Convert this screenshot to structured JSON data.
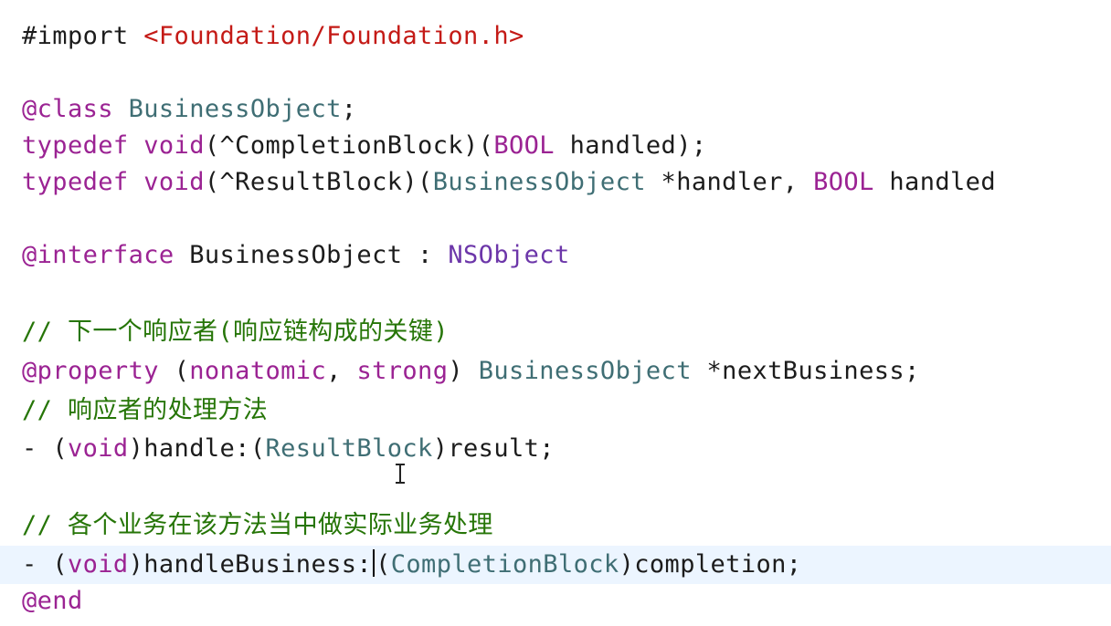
{
  "editor": {
    "import_directive": "#import",
    "import_path": "<Foundation/Foundation.h>",
    "class_keyword": "@class",
    "class_name": "BusinessObject",
    "semicolon": ";",
    "typedef_keyword": "typedef",
    "void_keyword": "void",
    "completion_block_text": "(^CompletionBlock)(",
    "bool_type": "BOOL",
    "handled_param": " handled);",
    "result_block_text": "(^ResultBlock)(",
    "business_object_type": "BusinessObject",
    "handler_param": " *handler, ",
    "handled_param_cut": " handled",
    "interface_keyword": "@interface",
    "interface_name": "BusinessObject",
    "colon": " : ",
    "superclass": "NSObject",
    "comment_next_responder": "// 下一个响应者(响应链构成的关键)",
    "property_keyword": "@property",
    "paren_open": "(",
    "nonatomic": "nonatomic",
    "comma": ", ",
    "strong": "strong",
    "paren_close": ")",
    "property_type": "BusinessObject",
    "property_name": "*nextBusiness;",
    "comment_handle_method": "// 响应者的处理方法",
    "minus": "- ",
    "void_type": "void",
    "handle_method": "handle:(",
    "result_block_type": "ResultBlock",
    "result_param": ")result;",
    "comment_business_method": "// 各个业务在该方法当中做实际业务处理",
    "handle_business_method": "handleBusiness:",
    "completion_block_type": "CompletionBlock",
    "completion_param": ")completion;",
    "end_keyword": "@end"
  },
  "colors": {
    "keyword": "#9b2393",
    "string": "#c41a16",
    "type": "#3f6e74",
    "system_type": "#6c36a9",
    "comment": "#267507",
    "current_line": "#ecf5ff"
  }
}
